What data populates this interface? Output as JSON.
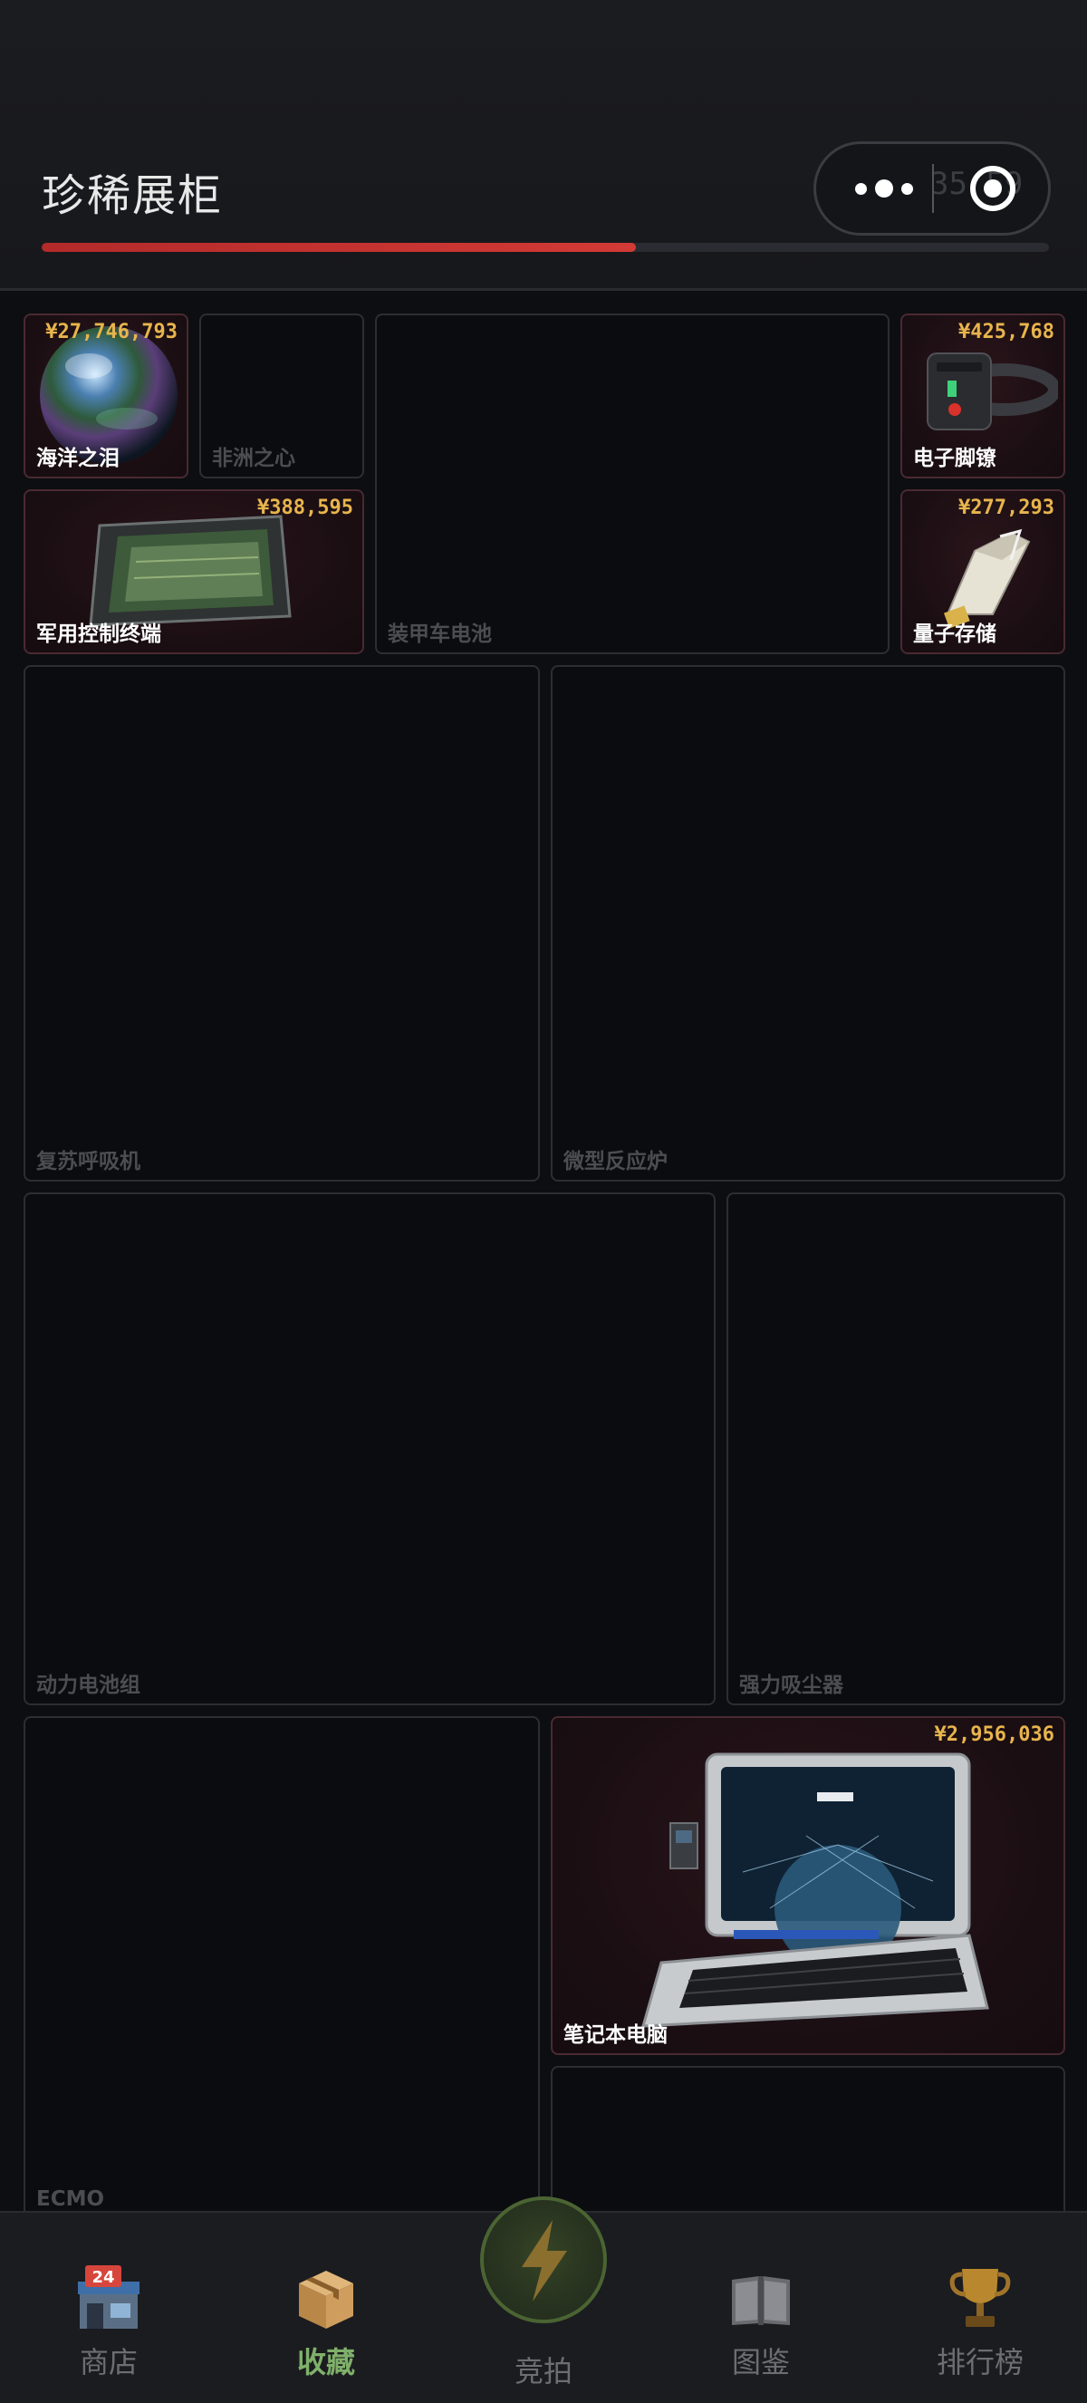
{
  "header": {
    "title": "珍稀展柜",
    "timer_text": "35 59",
    "progress_fraction": 0.59
  },
  "cells": {
    "ocean_tear": {
      "name": "海洋之泪",
      "price": "¥27,746,793"
    },
    "africa_heart": {
      "name": "非洲之心"
    },
    "armored_battery": {
      "name": "装甲车电池"
    },
    "electronic_shackle": {
      "name": "电子脚镣",
      "price": "¥425,768"
    },
    "military_terminal": {
      "name": "军用控制终端",
      "price": "¥388,595"
    },
    "quantum_storage": {
      "name": "量子存储",
      "price": "¥277,293"
    },
    "resuscitator": {
      "name": "复苏呼吸机"
    },
    "micro_reactor": {
      "name": "微型反应炉"
    },
    "power_battery_pack": {
      "name": "动力电池组"
    },
    "vacuum_cleaner": {
      "name": "强力吸尘器"
    },
    "ecmo": {
      "name": "ECMO"
    },
    "laptop": {
      "name": "笔记本电脑",
      "price": "¥2,956,036"
    }
  },
  "tabs": {
    "shop": {
      "label": "商店",
      "icon": "shop-icon",
      "badge": "24"
    },
    "collection": {
      "label": "收藏",
      "icon": "box-icon"
    },
    "auction": {
      "label": "竞拍",
      "icon": "lightning-icon"
    },
    "guide": {
      "label": "图鉴",
      "icon": "book-icon"
    },
    "ranking": {
      "label": "排行榜",
      "icon": "trophy-icon"
    }
  },
  "colors": {
    "price": "#e8b54c",
    "active_tab": "#7fb06a",
    "progress": "#d33a35"
  }
}
